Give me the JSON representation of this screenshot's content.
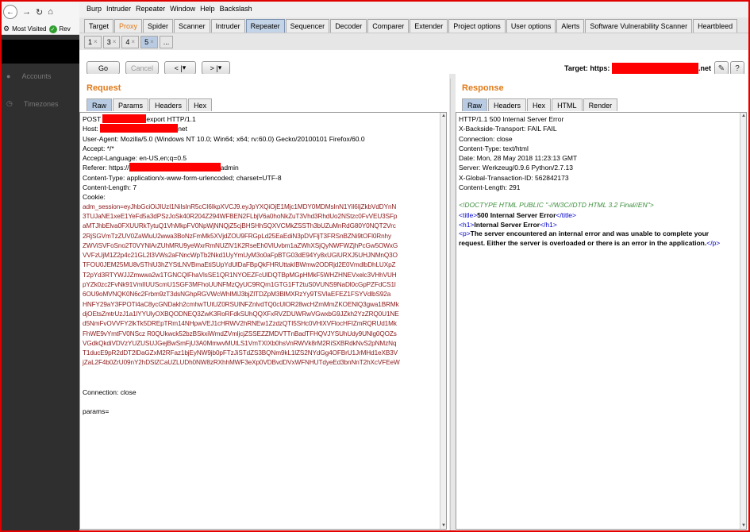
{
  "browser": {
    "bookmarks": {
      "most_visited": "Most Visited",
      "rev": "Rev"
    },
    "sidebar": [
      {
        "label": "Accounts",
        "icon": "person-icon"
      },
      {
        "label": "Timezones",
        "icon": "clock-icon"
      }
    ]
  },
  "menu": [
    "Burp",
    "Intruder",
    "Repeater",
    "Window",
    "Help",
    "Backslash"
  ],
  "main_tabs": [
    "Target",
    "Proxy",
    "Spider",
    "Scanner",
    "Intruder",
    "Repeater",
    "Sequencer",
    "Decoder",
    "Comparer",
    "Extender",
    "Project options",
    "User options",
    "Alerts",
    "Software Vulnerability Scanner",
    "Heartbleed"
  ],
  "active_main_tab": "Repeater",
  "repeater_tabs": [
    "1",
    "3",
    "4",
    "5",
    "..."
  ],
  "active_repeater_tab": "5",
  "toolbar": {
    "go": "Go",
    "cancel": "Cancel",
    "back": "<",
    "forward": ">",
    "dropdown": "▾",
    "target_label": "Target: https:",
    "target_suffix": ".net",
    "edit_icon": "pencil-icon",
    "help": "?"
  },
  "request": {
    "title": "Request",
    "tabs": [
      "Raw",
      "Params",
      "Headers",
      "Hex"
    ],
    "active_tab": "Raw",
    "line_post_prefix": "POST ",
    "line_post_suffix": "export HTTP/1.1",
    "line_host_prefix": "Host: ",
    "line_host_suffix": "net",
    "headers": [
      "User-Agent: Mozilla/5.0 (Windows NT 10.0; Win64; x64; rv:60.0) Gecko/20100101 Firefox/60.0",
      "Accept: */*",
      "Accept-Language: en-US,en;q=0.5"
    ],
    "referer_prefix": "Referer: https://",
    "referer_suffix": "admin",
    "headers2": [
      "Content-Type: application/x-www-form-urlencoded; charset=UTF-8",
      "Content-Length: 7",
      "Cookie:"
    ],
    "cookie_lines": [
      "adm_session=eyJhbGciOiJIUzI1NiIsInR5cCI6IkpXVCJ9.eyJpYXQiOjE1Mjc1MDY0MDMsInN1YiI6IjZkbVdDYnN",
      "3TUJaNE1xeE1YeFd5a3dPSzJoSk40R204Z294WFBEN2FLbjV6a0hoNkZuT3Vhd3RhdUo2NStzc0FvVEU3SFp",
      "aMTJhbElva0FXUURkTytuQ1VhMkpFV0NpWjNNQjZ5cjBHSHhSQXVCMkZSSTh3bUZuMnRdG80Y0NQT2Vrc",
      "2RjSGVmTzZUV0ZaWluU2wwa3BoNzFmMk5XVjdZOU9FRGpLd25EaEdiN3pDVFljT3FRSnBZNi9tOFl0Rnhy",
      "ZWViSVFoSno2T0VYNlArZUhMRU9yeWxrRmNUZlV1K2RseEh0VlUvbm1aZWhXSjQyNWFWZjhPcGw5OWxG",
      "VVFzUjM1Z2p4c21GL2l3VWs2aFNncWpTb2Nkd1UyYmUyM3o0aFpBTG03dE94Yy8xUGlURXJ5UHJNMnQ3O",
      "TFOU0JEM25MU8vSThlU3hZYStLNVBmaEtiSUpYdUlDaFBpQkFHRUttakIBWmw2ODRjd2E0VmdlbDhLUXpZ",
      "T2pYd3RTYWJJZmwwa2w1TGNCQlFhaVlsSE1QR1NYOEZFcUlDQTBpMGpHMkF5WHZHNEVxelc3VHhVUH",
      "pYZk0zc2FvNk91VmlIUUScmU1SGF3MFhoUUNFMzQyUC9RQm1GTG1FT2tuS0VUNS9NaDl0cGpPZFdCS1l",
      "6OU9oMVNQK0N6c2Frbm9zT3dsNGhpRGVWcWhIMlJ3bjZlTDZpM3BlMXRzYy9TSVlaEFEZ1FSYVdlbS92a",
      "HNFY29aY3FPOTl4aC8ycGNDakh2cmhwTUtUZ0RSUlNFZnlvdTQ0cUlOR28wcHZmMmZKOENlQ3gwa1BRMk",
      "djOEtsZmtrUzJ1a1lYYUlyOXBQODNEQ3ZwK3RoRFdkSUhQQXFxRVZDUWRwVGwxbG9JZkh2YzZRQ0U1NE",
      "d5NmFvOVVFY2lkTk5DREpTRm14NHpwVEJ1cHRWV2hRNEw1ZzdzQTI5SHc0VHlXVFlocHFIZmRQRUd1Mk",
      "FhWE9vYmtFV0NScz R0QUkwck52bzBSkxiWmdZVmljcjZSSEZZMDVTTnBadTFHQVJYSUhUdy9UNlg0QOZs",
      "VGdkQkdiVDVzYUZUSUJGejBwSmFjU3A0MmwvMUtLS1VmTXIXb0hsVnRWVk8rM2RiSXBRdkNvS2pNMzNq",
      "T1ducE9pR2dDT2lDaGZxM2RFaz1bjEyNW9jb0pFTzJiSTdZS3BQNm9kL1lZS2NYdGg4OFBrU1JrMHd1eXB3V",
      "jZaL2F4b0ZrU09nY2hDSlZCaUZLUDh0NW8zRXhhMWF3eXp0VDBvdDVxWFNHUTdyeEd3bnNnT2hXcVFEeW"
    ],
    "footer_lines": [
      "Connection: close",
      "",
      "params="
    ]
  },
  "response": {
    "title": "Response",
    "tabs": [
      "Raw",
      "Headers",
      "Hex",
      "HTML",
      "Render"
    ],
    "active_tab": "Raw",
    "headers": [
      "HTTP/1.1 500 Internal Server Error",
      "X-Backside-Transport: FAIL FAIL",
      "Connection: close",
      "Content-Type: text/html",
      "Date: Mon, 28 May 2018 11:23:13 GMT",
      "Server: Werkzeug/0.9.6 Python/2.7.13",
      "X-Global-Transaction-ID: 562842173",
      "Content-Length: 291"
    ],
    "doctype": "<!DOCTYPE HTML PUBLIC \"-//W3C//DTD HTML 3.2 Final//EN\">",
    "title_open": "<title>",
    "title_text": "500 Internal Server Error",
    "title_close": "</title>",
    "h1_open": "<h1>",
    "h1_text": "Internal Server Error",
    "h1_close": "</h1>",
    "p_open": "<p>",
    "p_text": "The server encountered an internal error and was unable to complete your request.  Either the server is overloaded or there is an error in the application.",
    "p_close": "</p>"
  }
}
